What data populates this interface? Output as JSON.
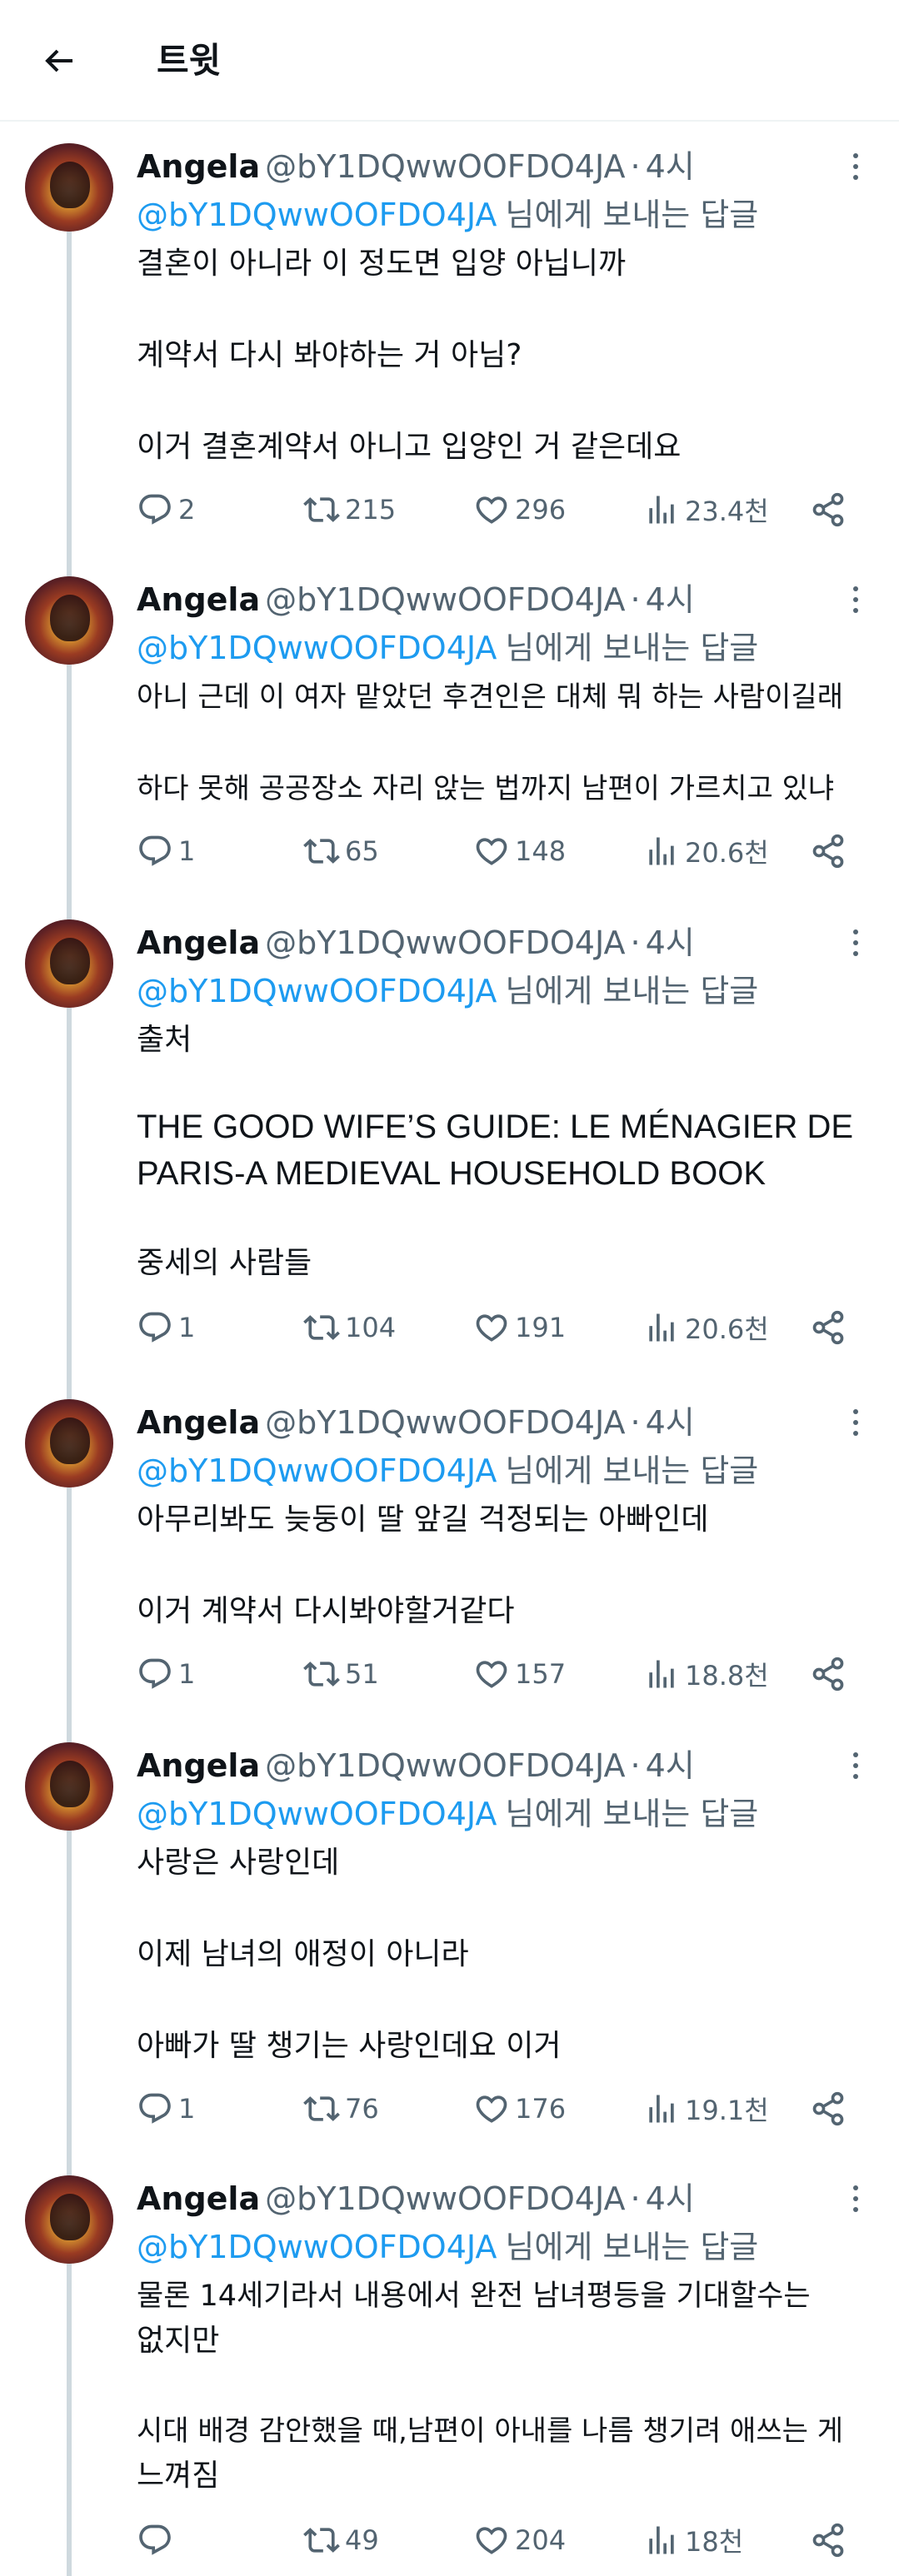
{
  "header": {
    "title": "트윗"
  },
  "tweets": [
    {
      "name": "Angela",
      "handle": "@bY1DQwwOOFDO4JA",
      "time": "4시",
      "reply_to": "@bY1DQwwOOFDO4JA",
      "reply_text": "님에게 보내는 답글",
      "lines": [
        "결혼이 아니라 이 정도면 입양 아닙니까",
        "계약서 다시 봐야하는 거 아님?",
        "이거 결혼계약서 아니고 입양인 거 같은데요"
      ],
      "replies": "2",
      "retweets": "215",
      "likes": "296",
      "views": "23.4천"
    },
    {
      "name": "Angela",
      "handle": "@bY1DQwwOOFDO4JA",
      "time": "4시",
      "reply_to": "@bY1DQwwOOFDO4JA",
      "reply_text": "님에게 보내는 답글",
      "lines": [
        "아니 근데 이 여자 맡았던 후견인은 대체 뭐 하는 사람이길래",
        "하다 못해 공공장소 자리 앉는 법까지 남편이 가르치고 있냐"
      ],
      "replies": "1",
      "retweets": "65",
      "likes": "148",
      "views": "20.6천"
    },
    {
      "name": "Angela",
      "handle": "@bY1DQwwOOFDO4JA",
      "time": "4시",
      "reply_to": "@bY1DQwwOOFDO4JA",
      "reply_text": "님에게 보내는 답글",
      "lines": [
        "출처",
        "THE GOOD WIFE’S GUIDE: LE MÉNAGIER DE",
        "PARIS-A MEDIEVAL HOUSEHOLD BOOK",
        "중세의 사람들"
      ],
      "replies": "1",
      "retweets": "104",
      "likes": "191",
      "views": "20.6천"
    },
    {
      "name": "Angela",
      "handle": "@bY1DQwwOOFDO4JA",
      "time": "4시",
      "reply_to": "@bY1DQwwOOFDO4JA",
      "reply_text": "님에게 보내는 답글",
      "lines": [
        "아무리봐도 늦둥이 딸 앞길 걱정되는 아빠인데",
        "이거 계약서 다시봐야할거같다"
      ],
      "replies": "1",
      "retweets": "51",
      "likes": "157",
      "views": "18.8천"
    },
    {
      "name": "Angela",
      "handle": "@bY1DQwwOOFDO4JA",
      "time": "4시",
      "reply_to": "@bY1DQwwOOFDO4JA",
      "reply_text": "님에게 보내는 답글",
      "lines": [
        "사랑은 사랑인데",
        "이제 남녀의 애정이 아니라",
        "아빠가 딸 챙기는 사랑인데요 이거"
      ],
      "replies": "1",
      "retweets": "76",
      "likes": "176",
      "views": "19.1천"
    },
    {
      "name": "Angela",
      "handle": "@bY1DQwwOOFDO4JA",
      "time": "4시",
      "reply_to": "@bY1DQwwOOFDO4JA",
      "reply_text": "님에게 보내는 답글",
      "lines": [
        "물론 14세기라서 내용에서 완전 남녀평등을 기대할수는",
        "없지만",
        "시대 배경 감안했을 때,남편이 아내를 나름 챙기려 애쓰는 게",
        "느껴짐"
      ],
      "replies": "",
      "retweets": "49",
      "likes": "204",
      "views": "18천"
    }
  ],
  "icons": {
    "back": "arrow-left-icon",
    "more": "more-vertical-icon",
    "reply": "reply-icon",
    "retweet": "retweet-icon",
    "like": "heart-icon",
    "views": "views-icon",
    "share": "share-icon"
  },
  "colors": {
    "link": "#1d9bf0",
    "secondary": "#536471",
    "text": "#0f1419",
    "thread_line": "#cfd9de"
  }
}
